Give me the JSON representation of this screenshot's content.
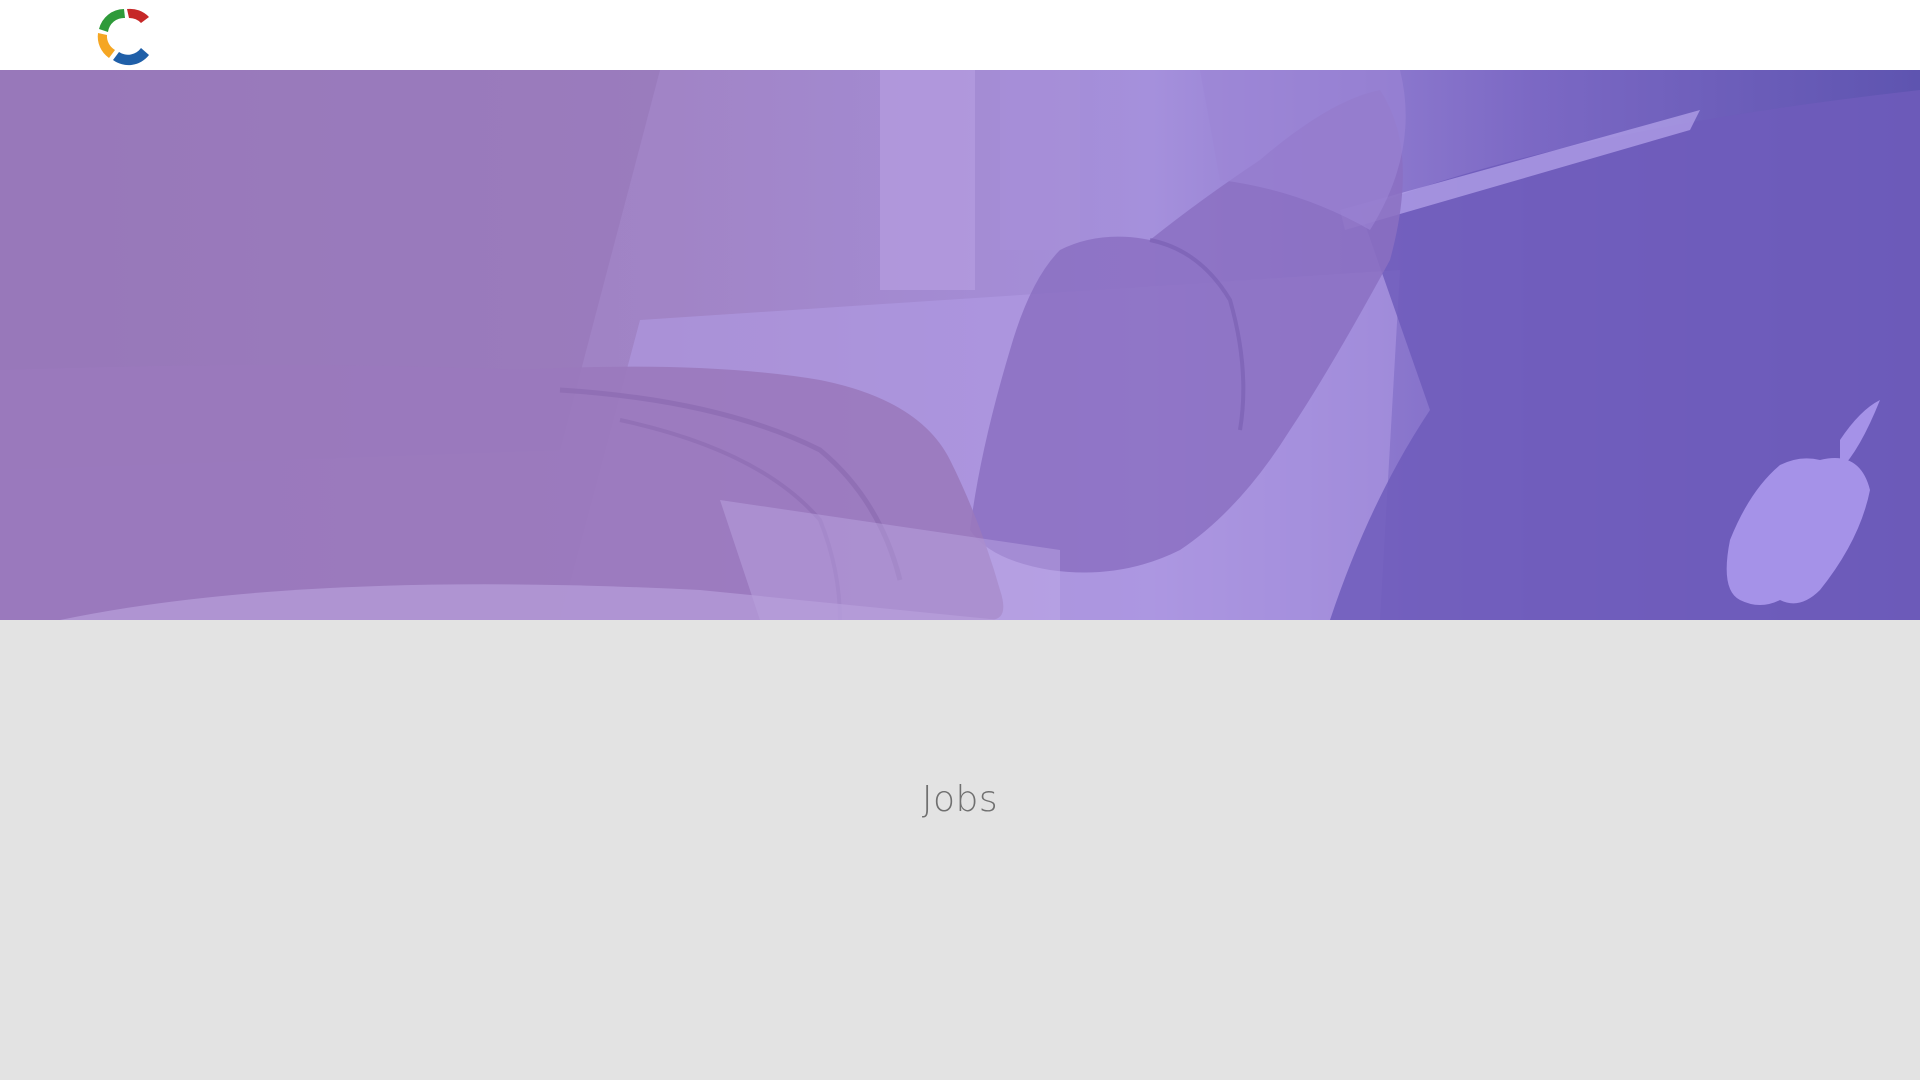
{
  "header": {
    "logo_icon": "multicolor-c-logo-icon",
    "logo_colors": [
      "#c62828",
      "#2e9a3a",
      "#f5a623",
      "#1f5fa8"
    ]
  },
  "hero": {
    "image": "hands-typing-on-laptop-photo",
    "overlay_color": "#9b7bc6"
  },
  "main": {
    "title": "Jobs"
  }
}
